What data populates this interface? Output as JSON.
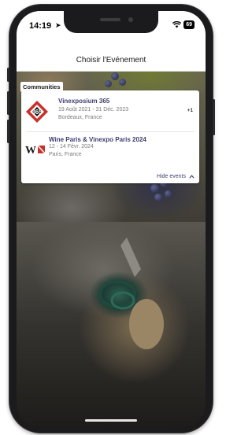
{
  "status_bar": {
    "time": "14:19",
    "battery": "69"
  },
  "nav": {
    "title": "Choisir l'Evénement"
  },
  "communities": {
    "section_label": "Communities",
    "events": [
      {
        "name": "Vinexposium 365",
        "dates": "19 Août 2021 - 31 Déc. 2023",
        "location": "Bordeaux, France",
        "extra_badge": "+1",
        "logo": "vinexposium-365-logo"
      },
      {
        "name": "Wine Paris & Vinexpo Paris 2024",
        "dates": "12 - 14 Févr. 2024",
        "location": "Paris, France",
        "logo": "wine-paris-logo"
      }
    ],
    "hide_label": "Hide events"
  },
  "colors": {
    "accent": "#3b3f6e",
    "logo_red": "#c8312b"
  }
}
